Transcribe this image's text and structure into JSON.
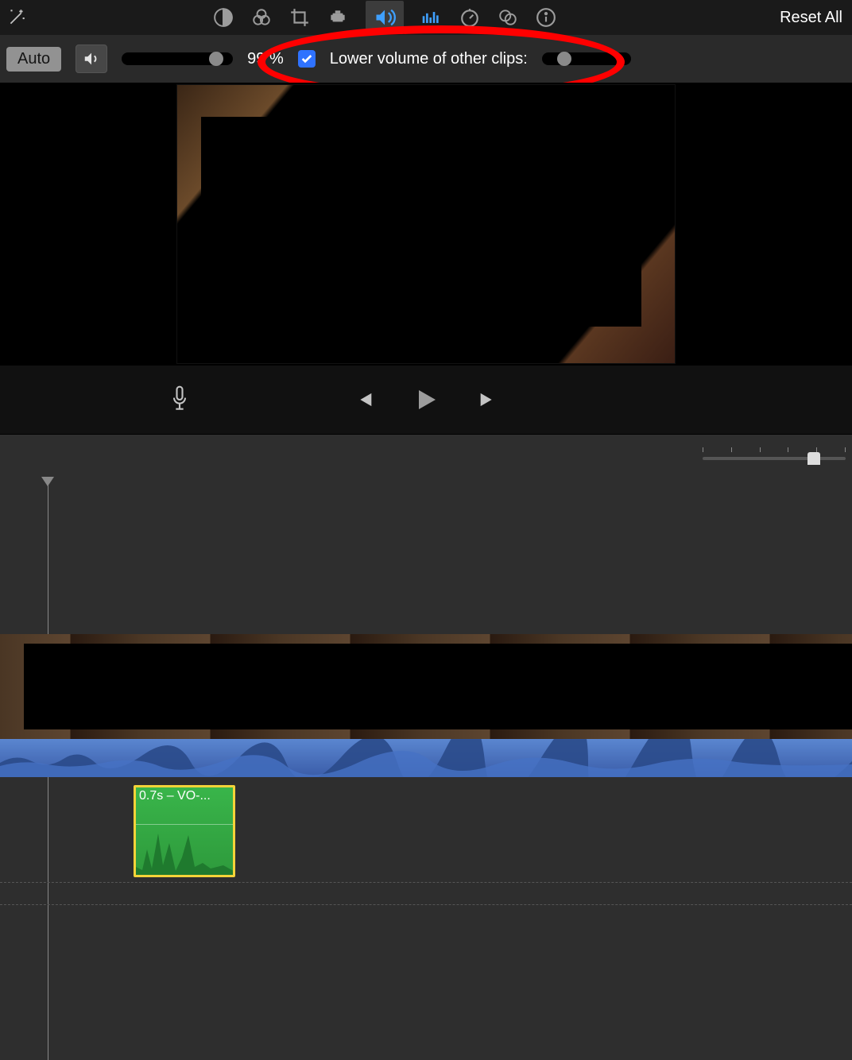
{
  "toolbar": {
    "reset_label": "Reset All"
  },
  "volume": {
    "auto_label": "Auto",
    "percent_label": "99 %",
    "lower_label": "Lower volume of other clips:",
    "checked": true
  },
  "voiceover": {
    "clip_label": "0.7s – VO-..."
  }
}
